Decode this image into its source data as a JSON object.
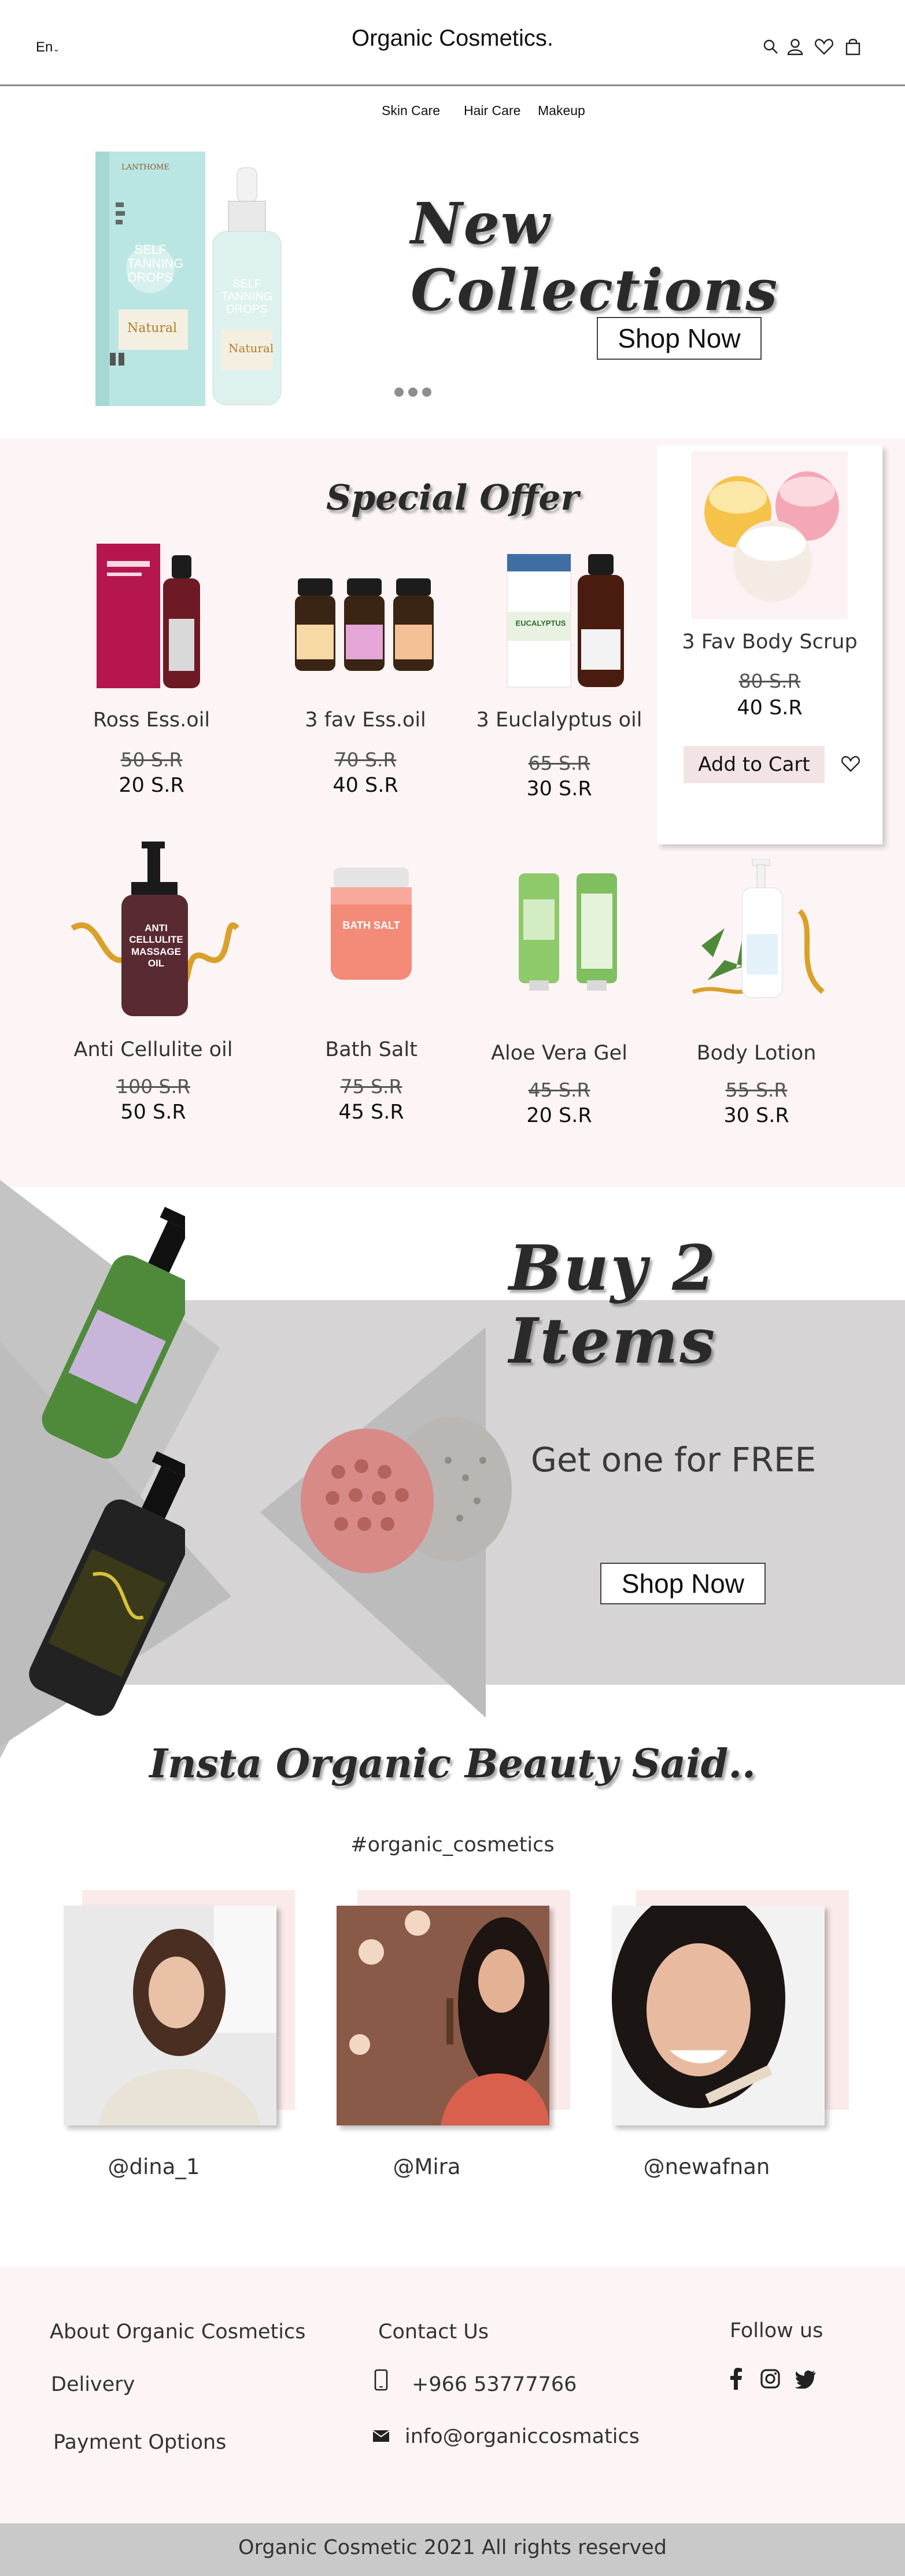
{
  "header": {
    "language": "En",
    "brand": "Organic Cosmetics.",
    "nav": [
      "Skin Care",
      "Hair Care",
      "Makeup"
    ]
  },
  "hero": {
    "title": "New Collections",
    "cta": "Shop Now",
    "product_brand": "LANTHOME",
    "product_label": "SELF TANNING DROPS",
    "product_badge": "Natural"
  },
  "offers": {
    "title": "Special Offer",
    "add_to_cart": "Add to Cart",
    "featured": {
      "name": "3 Fav Body Scrup",
      "old_price": "80 S.R",
      "new_price": "40 S.R"
    },
    "row1": [
      {
        "name": "Ross Ess.oil",
        "old_price": "50 S.R",
        "new_price": "20 S.R"
      },
      {
        "name": "3 fav Ess.oil",
        "old_price": "70 S.R",
        "new_price": "40 S.R"
      },
      {
        "name": "3 Euclalyptus oil",
        "old_price": "65 S.R",
        "new_price": "30 S.R"
      }
    ],
    "row2": [
      {
        "name": "Anti Cellulite oil",
        "old_price": "100 S.R",
        "new_price": "50 S.R"
      },
      {
        "name": "Bath Salt",
        "old_price": "75 S.R",
        "new_price": "45 S.R"
      },
      {
        "name": "Aloe Vera Gel",
        "old_price": "45 S.R",
        "new_price": "20 S.R"
      },
      {
        "name": "Body Lotion",
        "old_price": "55 S.R",
        "new_price": "30 S.R"
      }
    ],
    "bottle_labels": {
      "anti": "ANTI CELLULITE MASSAGE OIL",
      "salt": "BATH SALT",
      "euc": "EUCALYPTUS"
    }
  },
  "promo": {
    "title": "Buy 2 Items",
    "subtitle": "Get one for FREE",
    "cta": "Shop Now"
  },
  "insta": {
    "title": "Insta Organic Beauty Said..",
    "hashtag": "#organic_cosmetics",
    "handles": [
      "@dina_1",
      "@Mira",
      "@newafnan"
    ]
  },
  "footer": {
    "about": "About Organic Cosmetics",
    "delivery": "Delivery",
    "payment": "Payment Options",
    "contact": "Contact Us",
    "phone": "+966 53777766",
    "email": "info@organiccosmatics",
    "follow": "Follow us",
    "copyright": "Organic Cosmetic  2021 All rights reserved"
  },
  "colors": {
    "offer_bg": "#fdf5f5",
    "promo_band": "#d6d4d5",
    "cart_button": "#f2e4e4",
    "copyright_bar": "#c9c9c9"
  }
}
